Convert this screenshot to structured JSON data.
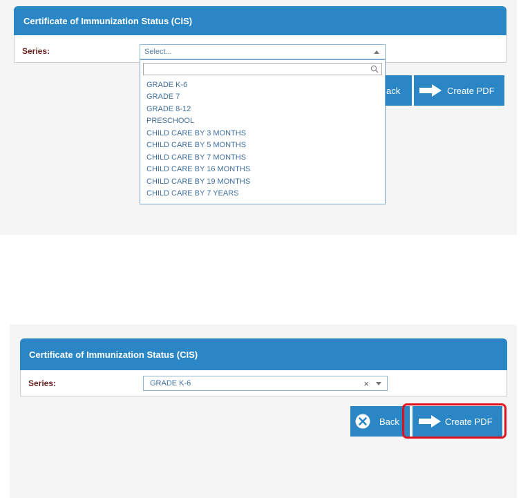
{
  "screen1": {
    "panel_title": "Certificate of Immunization Status (CIS)",
    "series_label": "Series:",
    "select_placeholder": "Select...",
    "search_placeholder": "",
    "options": [
      "GRADE K-6",
      "GRADE 7",
      "GRADE 8-12",
      "PRESCHOOL",
      "CHILD CARE BY 3 MONTHS",
      "CHILD CARE BY 5 MONTHS",
      "CHILD CARE BY 7 MONTHS",
      "CHILD CARE BY 16 MONTHS",
      "CHILD CARE BY 19 MONTHS",
      "CHILD CARE BY 7 YEARS"
    ],
    "back_partial": "ack",
    "create_pdf_label": "Create PDF"
  },
  "screen2": {
    "panel_title": "Certificate of Immunization Status (CIS)",
    "series_label": "Series:",
    "selected_value": "GRADE K-6",
    "clear_glyph": "×",
    "back_label": "Back",
    "create_pdf_label": "Create PDF"
  },
  "colors": {
    "header_blue": "#2a86c4",
    "label_red": "#6b1f1f",
    "highlight_red": "#e0111b"
  }
}
